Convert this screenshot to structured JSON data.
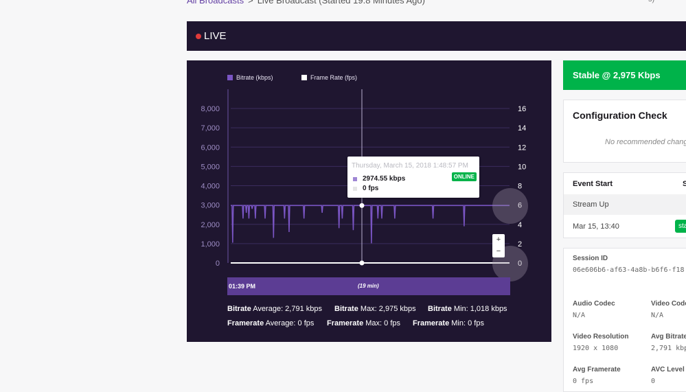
{
  "breadcrumb": {
    "link": "All Broadcasts",
    "separator": ">",
    "current": "Live Broadcast (Started 19.8 Minutes Ago)"
  },
  "top_right_text": "s)",
  "live_bar": {
    "label": "LIVE",
    "dot_color": "#e03a3a"
  },
  "chart_data": {
    "type": "line",
    "series": [
      {
        "name": "Bitrate (kbps)",
        "color": "#7a55c4",
        "axis": "left",
        "values": [
          2975,
          2975,
          2975,
          1050,
          2975,
          2975,
          2975,
          2975,
          2975,
          2975,
          2975,
          2975,
          2975,
          2975,
          2975,
          2975,
          2975,
          2975,
          2975,
          2300,
          2975,
          2975,
          2975,
          2975,
          2600,
          2975,
          2975,
          2975,
          2300,
          2975,
          2975,
          2975,
          2975,
          2800,
          2975,
          2975,
          2975,
          2975,
          2300,
          2975,
          2975,
          2975,
          2975,
          2975,
          2975,
          2975,
          2975,
          2975,
          2975,
          2975,
          2975,
          2975,
          2975,
          2300,
          2975,
          2975,
          2975,
          2975,
          2975,
          2975,
          2975,
          2975,
          2975,
          2975,
          2975,
          2975,
          1300,
          2975,
          2975,
          2975,
          2975,
          2975,
          2975,
          2975,
          2975,
          2975,
          2975,
          2975,
          2975,
          2975,
          2975,
          2975,
          2975,
          2300,
          2975,
          2975,
          2975,
          2975,
          2975,
          2975,
          1600,
          2975,
          2975,
          2975,
          2975,
          2975,
          2975,
          2975,
          2975,
          2975,
          2975,
          2975,
          2975,
          2975,
          2975,
          2975,
          2975,
          2975,
          2975,
          2975,
          2975,
          2975,
          2975,
          2300,
          2975,
          2975,
          2975,
          2975,
          2975,
          2975,
          2975,
          2975,
          2975,
          2975,
          2975,
          2975,
          2975,
          2975,
          2975,
          2975,
          2975,
          2975,
          2975,
          2975,
          2975,
          2975,
          2975,
          2975,
          2975,
          2975,
          2975,
          2600,
          2975,
          2975,
          2975,
          2975,
          2975,
          2975,
          2975,
          2975,
          2975,
          2975,
          2975,
          2975,
          2975,
          2975,
          2975,
          2975,
          2975,
          2975,
          2975,
          2975,
          2975,
          2975,
          2975,
          2975,
          2975,
          1800,
          2975,
          2975,
          2975,
          2975,
          2300,
          2975,
          2975,
          2975,
          2975,
          2975,
          2975,
          2975,
          2975,
          2975,
          2975,
          2975,
          2975,
          2975,
          2975,
          2975,
          2975,
          1700,
          2975,
          2975,
          2975,
          2975,
          2975,
          2975,
          2975,
          2975,
          2975,
          2975,
          2975,
          2975,
          2975,
          2975,
          2975,
          2975,
          2975,
          2975,
          2975,
          2975,
          2975,
          2975,
          2975,
          2975,
          2975,
          2975,
          2975,
          1018,
          2975,
          2975,
          2975,
          2975,
          2975,
          2975,
          2975,
          2975,
          2975,
          2300,
          2975,
          2975,
          2975,
          2975,
          2975,
          2300,
          2975,
          2975,
          2975,
          2975,
          2975,
          2975,
          2975,
          2975,
          2975,
          2975,
          2975,
          2975,
          2975,
          2975,
          2975,
          2975,
          2975,
          2975,
          2975,
          2300,
          2975,
          2975,
          2975,
          2975,
          2975,
          2975,
          2975,
          2975,
          2975,
          2975,
          2975,
          2975,
          2975,
          2975,
          2975,
          2975,
          2975,
          2975,
          2975,
          2975,
          2975,
          2975,
          2975,
          2975,
          2975,
          2975,
          2975,
          2975,
          2975,
          2975,
          2975,
          2975,
          2975,
          2975,
          2975,
          2975,
          2975,
          2975,
          2975,
          2975,
          2975,
          2975,
          2975,
          2975,
          2975,
          2975,
          2975,
          2975,
          2975,
          2975,
          2975,
          2975,
          2975,
          2975,
          2975,
          2975,
          2975,
          2975,
          2300,
          2975,
          2975,
          2975,
          2975,
          2975,
          2975,
          2975,
          2975,
          2975,
          2975,
          2975,
          2975,
          2975,
          2975,
          2975,
          2975,
          2975,
          2975,
          2975,
          2975,
          2975,
          2975,
          2975,
          2975,
          2975,
          2975,
          2975,
          2975,
          2975,
          2975,
          2975,
          2975,
          2975,
          2975,
          2975,
          2975,
          2975,
          2975,
          2975,
          2975,
          2975,
          2975,
          2975,
          2975,
          2975,
          2975,
          2975,
          1900,
          2975,
          2975,
          2975,
          2975,
          2975,
          2975,
          2975,
          2975,
          2975,
          2975,
          2975,
          2975,
          2975,
          2975,
          2975,
          2975,
          2975,
          2975,
          2975,
          2975,
          2975,
          2975,
          2975,
          2975,
          2975,
          2975,
          2975,
          2975,
          2975,
          2975,
          2975,
          2975,
          2975,
          2975,
          2975,
          2975,
          2975,
          2975,
          2975,
          2975,
          2975,
          2975,
          2975,
          2975,
          2975,
          2975,
          2975,
          2975,
          2975,
          2975,
          2975,
          2975,
          2975,
          2975,
          2975,
          2975,
          2975,
          2975,
          2975,
          2975,
          2975,
          2975,
          2975,
          2975,
          2975,
          2975,
          2975,
          2975,
          2975,
          2975
        ]
      },
      {
        "name": "Frame Rate (fps)",
        "color": "#ffffff",
        "axis": "right",
        "values": [
          0,
          0
        ]
      }
    ],
    "ylim_left": [
      0,
      8000
    ],
    "ylim_right": [
      0,
      16
    ],
    "left_ticks": [
      "0",
      "1,000",
      "2,000",
      "3,000",
      "4,000",
      "5,000",
      "6,000",
      "7,000",
      "8,000"
    ],
    "right_ticks": [
      "0",
      "2",
      "4",
      "6",
      "8",
      "10",
      "12",
      "14",
      "16"
    ],
    "grid": true,
    "legend_position": "top"
  },
  "tooltip": {
    "date": "Thursday, March 15, 2018 1:48:57 PM",
    "bitrate": "2974.55 kbps",
    "framerate": "0 fps",
    "status": "ONLINE"
  },
  "zoom": {
    "plus": "+",
    "minus": "−"
  },
  "timeline": {
    "start": "01:39 PM",
    "duration": "(19 min)"
  },
  "stats": {
    "bitrate_label": "Bitrate",
    "bitrate_avg": "Average: 2,791 kbps",
    "bitrate_max": "Max: 2,975 kbps",
    "bitrate_min": "Min: 1,018 kbps",
    "framerate_label": "Framerate",
    "framerate_avg": "Average: 0 fps",
    "framerate_max": "Max: 0 fps",
    "framerate_min": "Min: 0 fps"
  },
  "stable": "Stable @ 2,975 Kbps",
  "config": {
    "title": "Configuration Check",
    "note": "No recommended chang"
  },
  "event": {
    "header": "Event Start",
    "header2": "S",
    "row1": "Stream Up",
    "date": "Mar 15, 13:40",
    "badge": "sta"
  },
  "session": {
    "id_label": "Session ID",
    "id_value": "06e606b6-af63-4a8b-b6f6-f18",
    "audio_codec_label": "Audio Codec",
    "audio_codec_value": "N/A",
    "video_codec_label": "Video Code",
    "video_codec_value": "N/A",
    "video_res_label": "Video Resolution",
    "video_res_value": "1920 x 1080",
    "avg_bitrate_label": "Avg Bitrate",
    "avg_bitrate_value": "2,791 kbp",
    "avg_framerate_label": "Avg Framerate",
    "avg_framerate_value": "0 fps",
    "avc_level_label": "AVC Level",
    "avc_level_value": "0"
  },
  "colors": {
    "accent": "#6441a4",
    "panel": "#1f1630",
    "success": "#00b34a"
  }
}
